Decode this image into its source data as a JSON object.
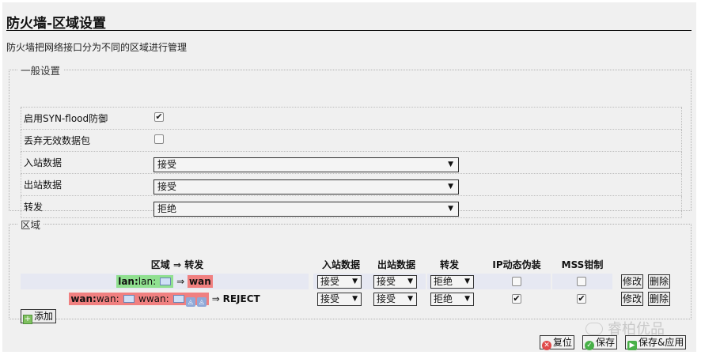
{
  "page": {
    "title": "防火墙-区域设置",
    "description": "防火墙把网络接口分为不同的区域进行管理"
  },
  "general": {
    "legend": "一般设置",
    "syn_flood_label": "启用SYN-flood防御",
    "syn_flood_checked": true,
    "drop_invalid_label": "丢弃无效数据包",
    "drop_invalid_checked": false,
    "input_label": "入站数据",
    "input_value": "接受",
    "output_label": "出站数据",
    "output_value": "接受",
    "forward_label": "转发",
    "forward_value": "拒绝"
  },
  "zones": {
    "legend": "区域",
    "headers": {
      "zone_forward": "区域 ⇒ 转发",
      "input": "入站数据",
      "output": "出站数据",
      "forward": "转发",
      "masq": "IP动态伪装",
      "mss": "MSS钳制"
    },
    "rows": [
      {
        "zone": "lan:",
        "ifaces": "lan:",
        "arrow": "⇒",
        "target": "wan",
        "input": "接受",
        "output": "接受",
        "forward": "拒绝",
        "masq": false,
        "mss": false
      },
      {
        "zone": "wan:",
        "ifaces": "wan:",
        "ifaces2": "wwan:",
        "arrow": "⇒",
        "target": "REJECT",
        "input": "接受",
        "output": "接受",
        "forward": "拒绝",
        "masq": true,
        "mss": true
      }
    ],
    "edit_label": "修改",
    "delete_label": "删除",
    "add_label": "添加"
  },
  "watermark": "睿柏优品",
  "footer": {
    "reset_label": "复位",
    "save_label": "保存",
    "save_apply_label": "保存&应用"
  }
}
